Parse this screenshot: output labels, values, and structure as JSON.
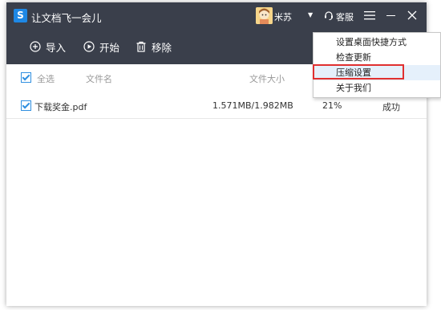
{
  "app": {
    "title": "让文档飞一会儿",
    "logo": "S"
  },
  "user": {
    "name": "米苏"
  },
  "titlebar": {
    "support_label": "客服"
  },
  "toolbar": {
    "import_label": "导入",
    "start_label": "开始",
    "remove_label": "移除"
  },
  "table": {
    "select_all_label": "全选",
    "columns": [
      "文件名",
      "文件大小"
    ],
    "rows": [
      {
        "name": "下载奖金.pdf",
        "size": "1.571MB/1.982MB",
        "ratio": "21%",
        "status": "成功"
      }
    ]
  },
  "menu": {
    "items": [
      {
        "label": "设置桌面快捷方式"
      },
      {
        "label": "检查更新"
      },
      {
        "label": "压缩设置"
      },
      {
        "label": "关于我们"
      }
    ]
  },
  "colors": {
    "titlebar_bg": "#3a3f4b",
    "accent": "#2f8fe0",
    "highlight_border": "#e03030"
  }
}
